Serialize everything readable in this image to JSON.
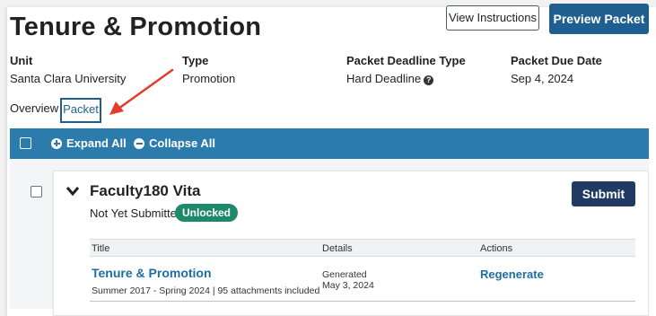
{
  "header": {
    "title": "Tenure & Promotion",
    "view_instructions_label": "View Instructions",
    "preview_packet_label": "Preview Packet"
  },
  "meta": {
    "unit_label": "Unit",
    "unit_value": "Santa Clara University",
    "type_label": "Type",
    "type_value": "Promotion",
    "deadline_type_label": "Packet Deadline Type",
    "deadline_type_value": "Hard Deadline",
    "due_date_label": "Packet Due Date",
    "due_date_value": "Sep 4, 2024"
  },
  "tabs": [
    {
      "label": "Overview"
    },
    {
      "label": "Packet",
      "active": true
    }
  ],
  "toolbar": {
    "expand_all_label": "Expand All",
    "collapse_all_label": "Collapse All"
  },
  "section": {
    "title": "Faculty180 Vita",
    "status": "Not Yet Submitted",
    "badge": "Unlocked",
    "submit_label": "Submit"
  },
  "table": {
    "columns": [
      "Title",
      "Details",
      "Actions"
    ],
    "rows": [
      {
        "title": "Tenure & Promotion",
        "subtitle": "Summer 2017 - Spring 2024 | 95 attachments included",
        "details_line1": "Generated",
        "details_line2": "May 3, 2024",
        "action": "Regenerate"
      }
    ]
  },
  "colors": {
    "primary": "#1f5f8f",
    "toolbar": "#2b7bad",
    "badge_green": "#1f8a6b",
    "submit_navy": "#203a63",
    "annotation_arrow": "#e53b2c"
  },
  "icons": {
    "help": "question-circle-icon",
    "expand": "plus-circle-icon",
    "collapse": "minus-circle-icon",
    "toggle": "chevron-down-icon"
  }
}
